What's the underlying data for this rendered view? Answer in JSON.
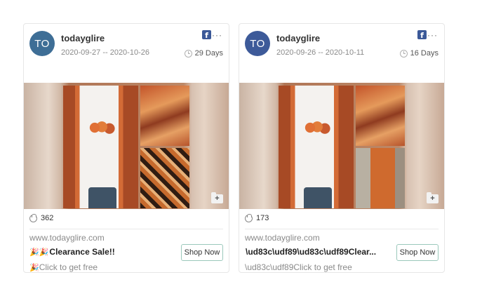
{
  "ads": [
    {
      "avatar_initials": "TO",
      "avatar_color": "#3e6e96",
      "advertiser": "todayglire",
      "date_range": "2020-09-27 -- 2020-10-26",
      "duration": "29 Days",
      "platform_icon": "facebook-icon",
      "likes": "362",
      "domain": "www.todayglire.com",
      "headline_emoji": "🎉🎉",
      "headline": "Clearance Sale!!",
      "subline_emoji": "🎉",
      "subline": "Click to get free",
      "cta": "Shop Now"
    },
    {
      "avatar_initials": "TO",
      "avatar_color": "#3d5a99",
      "advertiser": "todayglire",
      "date_range": "2020-09-26 -- 2020-10-11",
      "duration": "16 Days",
      "platform_icon": "facebook-icon",
      "likes": "173",
      "domain": "www.todayglire.com",
      "headline_emoji": "",
      "headline": "\\ud83c\\udf89\\ud83c\\udf89Clear...",
      "subline_emoji": "",
      "subline": "\\ud83c\\udf89Click to get free",
      "cta": "Shop Now"
    }
  ],
  "icons": {
    "facebook": "f",
    "more": "···",
    "folder_add": "+"
  }
}
